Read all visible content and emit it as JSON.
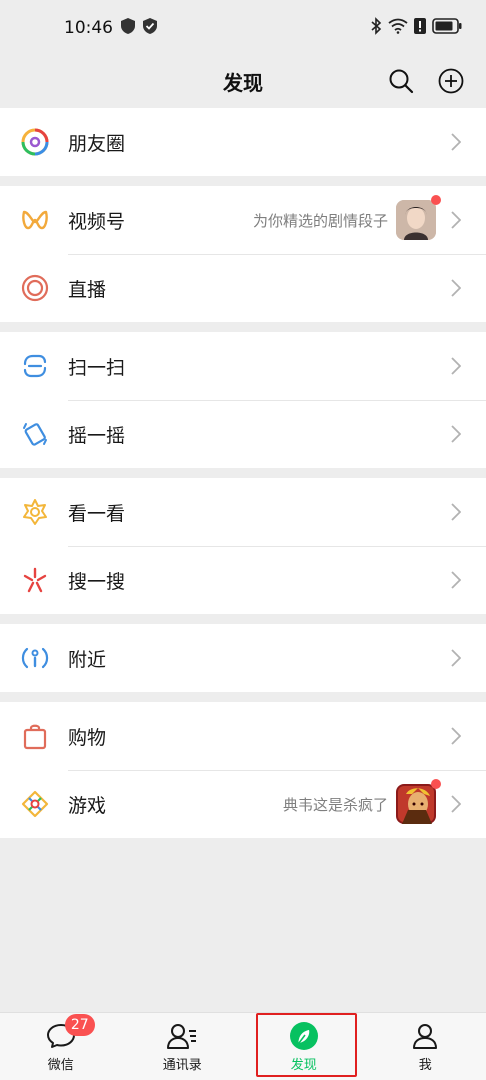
{
  "status": {
    "time": "10:46"
  },
  "header": {
    "title": "发现"
  },
  "groups": [
    {
      "items": [
        {
          "label": "朋友圈",
          "icon": "moments-icon"
        }
      ]
    },
    {
      "items": [
        {
          "label": "视频号",
          "icon": "channels-icon",
          "sub": "为你精选的剧情段子",
          "has_thumb": true,
          "dot": true
        },
        {
          "label": "直播",
          "icon": "live-icon"
        }
      ]
    },
    {
      "items": [
        {
          "label": "扫一扫",
          "icon": "scan-icon"
        },
        {
          "label": "摇一摇",
          "icon": "shake-icon"
        }
      ]
    },
    {
      "items": [
        {
          "label": "看一看",
          "icon": "top-stories-icon"
        },
        {
          "label": "搜一搜",
          "icon": "search-icon"
        }
      ]
    },
    {
      "items": [
        {
          "label": "附近",
          "icon": "nearby-icon"
        }
      ]
    },
    {
      "items": [
        {
          "label": "购物",
          "icon": "shopping-icon"
        },
        {
          "label": "游戏",
          "icon": "games-icon",
          "sub": "典韦这是杀疯了",
          "has_thumb": true,
          "dot": true
        }
      ]
    }
  ],
  "tabs": [
    {
      "label": "微信",
      "badge": "27"
    },
    {
      "label": "通讯录"
    },
    {
      "label": "发现",
      "active": true
    },
    {
      "label": "我"
    }
  ],
  "colors": {
    "accent": "#07c160",
    "badge": "#fa5151",
    "highlight": "#e02020"
  }
}
